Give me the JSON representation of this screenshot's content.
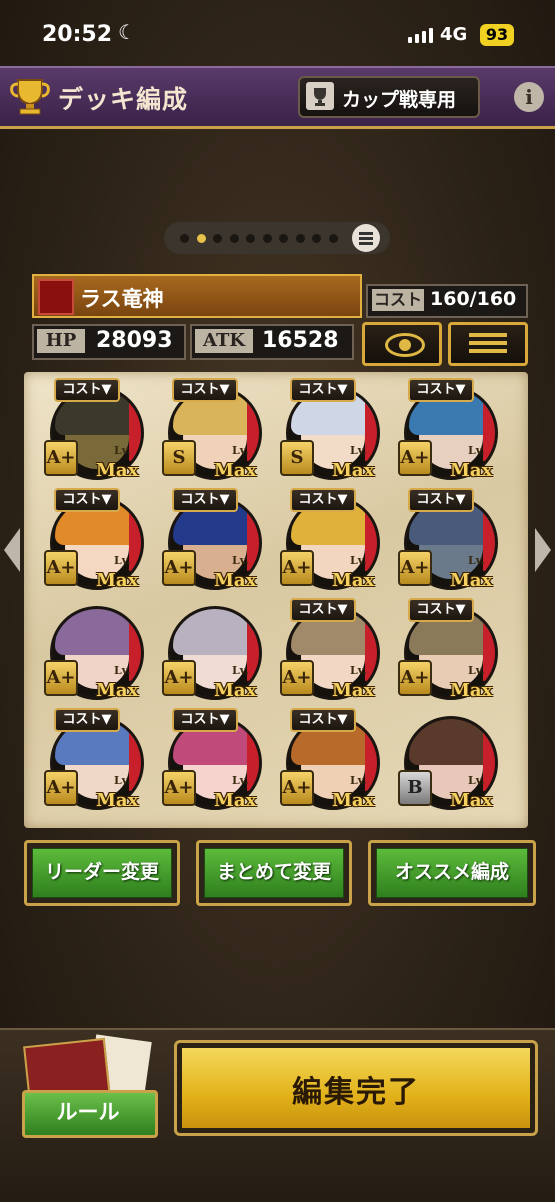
{
  "status": {
    "time": "20:52",
    "network": "4G",
    "battery": "93"
  },
  "header": {
    "title": "デッキ編成",
    "mode_button": "カップ戦専用",
    "info": "i"
  },
  "pager": {
    "page_count": 10,
    "current": 2
  },
  "deck": {
    "name": "ラス竜神",
    "cost_label": "コスト",
    "cost_value": "160/160",
    "hp_label": "HP",
    "hp_value": "28093",
    "atk_label": "ATK",
    "atk_value": "16528"
  },
  "cards": [
    {
      "cost": "コスト▼",
      "rank": "A+",
      "lv": "Lv.",
      "level": "Max",
      "hair": "#3b3a2a",
      "skin": "#7a6a3a"
    },
    {
      "cost": "コスト▼",
      "rank": "S",
      "lv": "Lv.",
      "level": "Max",
      "hair": "#d9b45a",
      "skin": "#f0d2b8"
    },
    {
      "cost": "コスト▼",
      "rank": "S",
      "lv": "Lv.",
      "level": "Max",
      "hair": "#cfd6e6",
      "skin": "#f2dcc8"
    },
    {
      "cost": "コスト▼",
      "rank": "A+",
      "lv": "Lv.",
      "level": "Max",
      "hair": "#3a7ab0",
      "skin": "#e8d0c0"
    },
    {
      "cost": "コスト▼",
      "rank": "A+",
      "lv": "Lv.",
      "level": "Max",
      "hair": "#e08a2a",
      "skin": "#f4d8c2"
    },
    {
      "cost": "コスト▼",
      "rank": "A+",
      "lv": "Lv.",
      "level": "Max",
      "hair": "#233a8a",
      "skin": "#d8b090"
    },
    {
      "cost": "コスト▼",
      "rank": "A+",
      "lv": "Lv.",
      "level": "Max",
      "hair": "#e0b23a",
      "skin": "#f2d6c0"
    },
    {
      "cost": "コスト▼",
      "rank": "A+",
      "lv": "Lv.",
      "level": "Max",
      "hair": "#4a5a7a",
      "skin": "#6a7a8a"
    },
    {
      "cost": "",
      "rank": "A+",
      "lv": "Lv.",
      "level": "Max",
      "hair": "#8a6a9a",
      "skin": "#f0d4c8"
    },
    {
      "cost": "",
      "rank": "A+",
      "lv": "Lv.",
      "level": "Max",
      "hair": "#b8b2c0",
      "skin": "#f0dcd2"
    },
    {
      "cost": "コスト▼",
      "rank": "A+",
      "lv": "Lv.",
      "level": "Max",
      "hair": "#a08a6a",
      "skin": "#f2d8c4"
    },
    {
      "cost": "コスト▼",
      "rank": "A+",
      "lv": "Lv.",
      "level": "Max",
      "hair": "#8a7a5a",
      "skin": "#e8ccb4"
    },
    {
      "cost": "コスト▼",
      "rank": "A+",
      "lv": "Lv.",
      "level": "Max",
      "hair": "#5a7ac0",
      "skin": "#f0d8c8"
    },
    {
      "cost": "コスト▼",
      "rank": "A+",
      "lv": "Lv.",
      "level": "Max",
      "hair": "#c04a7a",
      "skin": "#f4d4cc"
    },
    {
      "cost": "コスト▼",
      "rank": "A+",
      "lv": "Lv.",
      "level": "Max",
      "hair": "#b86a2a",
      "skin": "#f0d0b4"
    },
    {
      "cost": "",
      "rank": "B",
      "lv": "Lv.",
      "level": "Max",
      "hair": "#5a3a2a",
      "skin": "#e8c8b8"
    }
  ],
  "actions": {
    "leader": "リーダー変更",
    "bulk": "まとめて変更",
    "recommend": "オススメ編成"
  },
  "footer": {
    "rule": "ルール",
    "done": "編集完了"
  },
  "colors": {
    "accent_gold": "#c9a24a",
    "action_green": "#3a8f24",
    "done_yellow": "#e2b21a"
  }
}
